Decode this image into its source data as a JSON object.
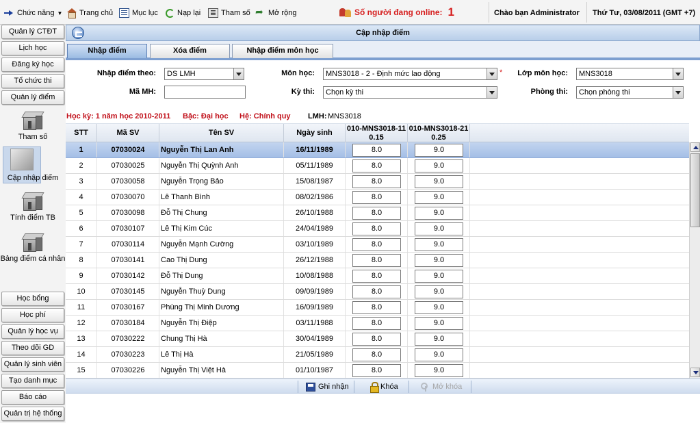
{
  "topbar": {
    "menu_label": "Chức năng",
    "home_label": "Trang chủ",
    "toc_label": "Mục lục",
    "reload_label": "Nạp lại",
    "params_label": "Tham số",
    "expand_label": "Mở rộng",
    "online_label": "Số người đang online:",
    "online_count": "1",
    "welcome": "Chào bạn Administrator",
    "datetime": "Thứ Tư, 03/08/2011 (GMT +7)"
  },
  "sidebar": {
    "buttons_top": [
      "Quản lý CTĐT",
      "Lịch học",
      "Đăng ký học",
      "Tổ chức thi",
      "Quản lý điểm"
    ],
    "icons": [
      {
        "label": "Tham số",
        "icon": "cube-icon"
      },
      {
        "label": "Cập nhập điểm",
        "icon": "grades-edit-icon",
        "active": true
      },
      {
        "label": "Tính điểm TB",
        "icon": "cube-icon"
      },
      {
        "label": "Bảng điểm cá nhân",
        "icon": "cube-icon"
      }
    ],
    "buttons_bottom": [
      "Học bổng",
      "Học phí",
      "Quản lý học vụ",
      "Theo dõi GD",
      "Quản lý sinh viên",
      "Tạo danh mục",
      "Báo cáo",
      "Quản trị hệ thống"
    ]
  },
  "panel": {
    "title": "Cập nhập điểm"
  },
  "tabs": [
    {
      "label": "Nhập điểm",
      "active": true
    },
    {
      "label": "Xóa điểm",
      "active": false
    },
    {
      "label": "Nhập điểm môn học",
      "active": false
    }
  ],
  "form": {
    "nhap_diem_theo_label": "Nhập điểm theo:",
    "nhap_diem_theo_value": "DS LMH",
    "mon_hoc_label": "Môn học:",
    "mon_hoc_value": "MNS3018 - 2 - Định mức lao động",
    "required_mark": "*",
    "lop_mon_hoc_label": "Lớp môn học:",
    "lop_mon_hoc_value": "MNS3018",
    "ma_mh_label": "Mã MH:",
    "ma_mh_value": "",
    "ky_thi_label": "Kỳ thi:",
    "ky_thi_value": "Chọn kỳ thi",
    "phong_thi_label": "Phòng thi:",
    "phong_thi_value": "Chọn phòng thi"
  },
  "info": {
    "hoc_ky": "Học kỳ: 1 năm học 2010-2011",
    "bac": "Bậc: Đại học",
    "he": "Hệ: Chính quy",
    "lmh_label": "LMH:",
    "lmh_value": "MNS3018"
  },
  "grid": {
    "headers": {
      "stt": "STT",
      "ma_sv": "Mã SV",
      "ten_sv": "Tên SV",
      "ngay_sinh": "Ngày sinh",
      "diem1_line1": "010-MNS3018-11",
      "diem1_line2": "0.15",
      "diem2_line1": "010-MNS3018-21",
      "diem2_line2": "0.25"
    },
    "rows": [
      {
        "stt": "1",
        "ma_sv": "07030024",
        "ten": "Nguyễn Thị Lan Anh",
        "ngay_sinh": "16/11/1989",
        "d1": "8.0",
        "d2": "9.0",
        "selected": true
      },
      {
        "stt": "2",
        "ma_sv": "07030025",
        "ten": "Nguyễn Thị Quỳnh Anh",
        "ngay_sinh": "05/11/1989",
        "d1": "8.0",
        "d2": "9.0"
      },
      {
        "stt": "3",
        "ma_sv": "07030058",
        "ten": "Nguyễn Trọng Bảo",
        "ngay_sinh": "15/08/1987",
        "d1": "8.0",
        "d2": "9.0"
      },
      {
        "stt": "4",
        "ma_sv": "07030070",
        "ten": "Lê Thanh Bình",
        "ngay_sinh": "08/02/1986",
        "d1": "8.0",
        "d2": "9.0"
      },
      {
        "stt": "5",
        "ma_sv": "07030098",
        "ten": "Đỗ Thị Chung",
        "ngay_sinh": "26/10/1988",
        "d1": "8.0",
        "d2": "9.0"
      },
      {
        "stt": "6",
        "ma_sv": "07030107",
        "ten": "Lê Thị Kim Cúc",
        "ngay_sinh": "24/04/1989",
        "d1": "8.0",
        "d2": "9.0"
      },
      {
        "stt": "7",
        "ma_sv": "07030114",
        "ten": "Nguyễn Mạnh Cường",
        "ngay_sinh": "03/10/1989",
        "d1": "8.0",
        "d2": "9.0"
      },
      {
        "stt": "8",
        "ma_sv": "07030141",
        "ten": "Cao Thị Dung",
        "ngay_sinh": "26/12/1988",
        "d1": "8.0",
        "d2": "9.0"
      },
      {
        "stt": "9",
        "ma_sv": "07030142",
        "ten": "Đỗ Thị Dung",
        "ngay_sinh": "10/08/1988",
        "d1": "8.0",
        "d2": "9.0"
      },
      {
        "stt": "10",
        "ma_sv": "07030145",
        "ten": "Nguyễn Thuỳ Dung",
        "ngay_sinh": "09/09/1989",
        "d1": "8.0",
        "d2": "9.0"
      },
      {
        "stt": "11",
        "ma_sv": "07030167",
        "ten": "Phùng Thị Minh Dương",
        "ngay_sinh": "16/09/1989",
        "d1": "8.0",
        "d2": "9.0"
      },
      {
        "stt": "12",
        "ma_sv": "07030184",
        "ten": "Nguyễn Thị Điệp",
        "ngay_sinh": "03/11/1988",
        "d1": "8.0",
        "d2": "9.0"
      },
      {
        "stt": "13",
        "ma_sv": "07030222",
        "ten": "Chung Thị Hà",
        "ngay_sinh": "30/04/1989",
        "d1": "8.0",
        "d2": "9.0"
      },
      {
        "stt": "14",
        "ma_sv": "07030223",
        "ten": "Lê Thị Hà",
        "ngay_sinh": "21/05/1989",
        "d1": "8.0",
        "d2": "9.0"
      },
      {
        "stt": "15",
        "ma_sv": "07030226",
        "ten": "Nguyễn Thị Việt Hà",
        "ngay_sinh": "01/10/1987",
        "d1": "8.0",
        "d2": "9.0"
      }
    ]
  },
  "bottom": {
    "save_label": "Ghi nhận",
    "lock_label": "Khóa",
    "unlock_label": "Mở khóa"
  }
}
